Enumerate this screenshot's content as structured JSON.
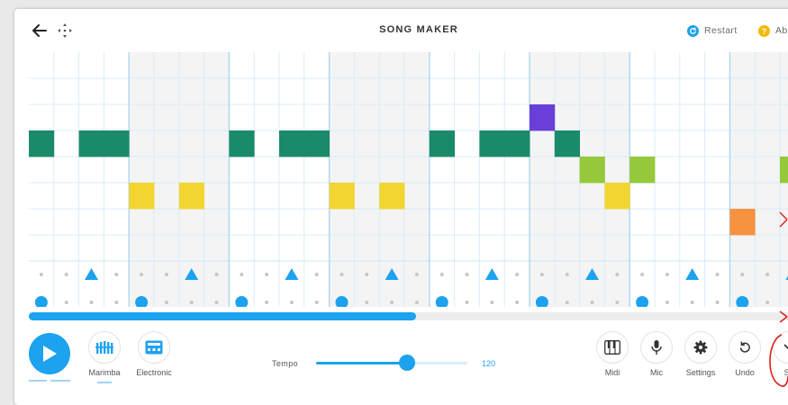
{
  "header": {
    "title": "SONG MAKER",
    "restart_label": "Restart",
    "about_label": "Ab"
  },
  "grid": {
    "columns": 32,
    "melody_rows": 8,
    "beats_per_bar": 4,
    "notes": [
      {
        "col": 0,
        "row": 3,
        "color": "#1a8a6a"
      },
      {
        "col": 2,
        "row": 3,
        "color": "#1a8a6a"
      },
      {
        "col": 3,
        "row": 3,
        "color": "#1a8a6a"
      },
      {
        "col": 4,
        "row": 5,
        "color": "#f2d531"
      },
      {
        "col": 6,
        "row": 5,
        "color": "#f2d531"
      },
      {
        "col": 8,
        "row": 3,
        "color": "#1a8a6a"
      },
      {
        "col": 10,
        "row": 3,
        "color": "#1a8a6a"
      },
      {
        "col": 11,
        "row": 3,
        "color": "#1a8a6a"
      },
      {
        "col": 12,
        "row": 5,
        "color": "#f2d531"
      },
      {
        "col": 14,
        "row": 5,
        "color": "#f2d531"
      },
      {
        "col": 16,
        "row": 3,
        "color": "#1a8a6a"
      },
      {
        "col": 18,
        "row": 3,
        "color": "#1a8a6a"
      },
      {
        "col": 19,
        "row": 3,
        "color": "#1a8a6a"
      },
      {
        "col": 20,
        "row": 2,
        "color": "#6a3ed8"
      },
      {
        "col": 21,
        "row": 3,
        "color": "#1a8a6a"
      },
      {
        "col": 22,
        "row": 4,
        "color": "#96c83b"
      },
      {
        "col": 23,
        "row": 5,
        "color": "#f2d531"
      },
      {
        "col": 24,
        "row": 4,
        "color": "#96c83b"
      },
      {
        "col": 28,
        "row": 6,
        "color": "#f69240"
      },
      {
        "col": 30,
        "row": 4,
        "color": "#96c83b"
      }
    ],
    "triangle_cols": [
      2,
      6,
      10,
      14,
      18,
      22,
      26,
      30
    ],
    "circle_cols": [
      0,
      4,
      8,
      12,
      16,
      20,
      24,
      28
    ],
    "playhead_fraction": 0.5
  },
  "controls": {
    "instruments": [
      {
        "name": "piano-keys-icon",
        "label": "Marimba"
      },
      {
        "name": "drum-machine-icon",
        "label": "Electronic"
      }
    ],
    "tempo_label": "Tempo",
    "tempo_value": "120",
    "tempo_fraction": 0.6,
    "right_buttons": [
      {
        "id": "midi",
        "icon": "piano-icon",
        "label": "Midi"
      },
      {
        "id": "mic",
        "icon": "microphone-icon",
        "label": "Mic"
      },
      {
        "id": "settings",
        "icon": "gear-icon",
        "label": "Settings"
      },
      {
        "id": "undo",
        "icon": "undo-icon",
        "label": "Undo"
      },
      {
        "id": "save",
        "icon": "chevron-down-icon",
        "label": "Sa"
      }
    ]
  },
  "colors": {
    "accent": "#1ca2ee",
    "grid_line": "#d8ecf8",
    "bar_line": "#a7d5f2",
    "shaded_bar": "#f4f4f4",
    "annotation": "#e0201b"
  }
}
